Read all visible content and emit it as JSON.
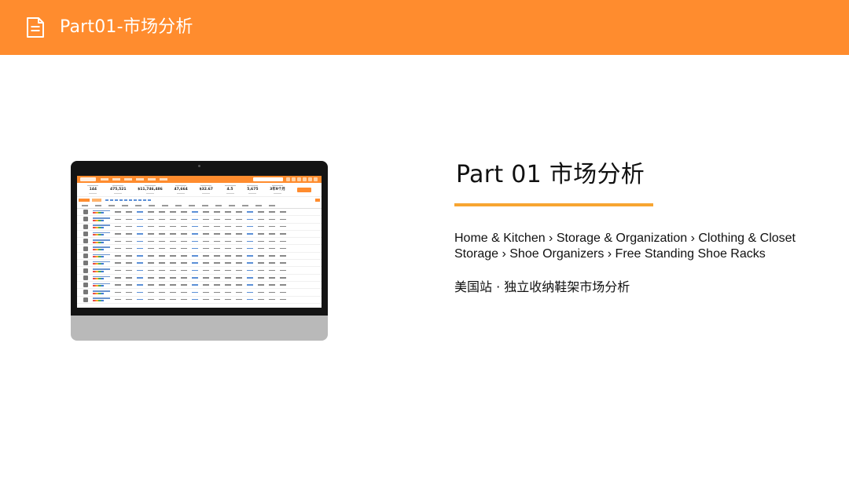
{
  "header": {
    "title": "Part01-市场分析",
    "icon": "document-icon",
    "background": "#ff8c2e"
  },
  "section": {
    "title": "Part 01  市场分析",
    "accent_color": "#f7a531",
    "breadcrumb_line1": "Home & Kitchen › Storage & Organization › Clothing & Closet",
    "breadcrumb_line2": "Storage › Shoe Organizers › Free Standing Shoe Racks",
    "subtitle": "美国站 · 独立收纳鞋架市场分析"
  },
  "screenshot": {
    "stats": [
      "144",
      "475,521",
      "$11,746,486",
      "47,664",
      "$32.67",
      "4.5",
      "5,675",
      "3年9个月"
    ]
  }
}
